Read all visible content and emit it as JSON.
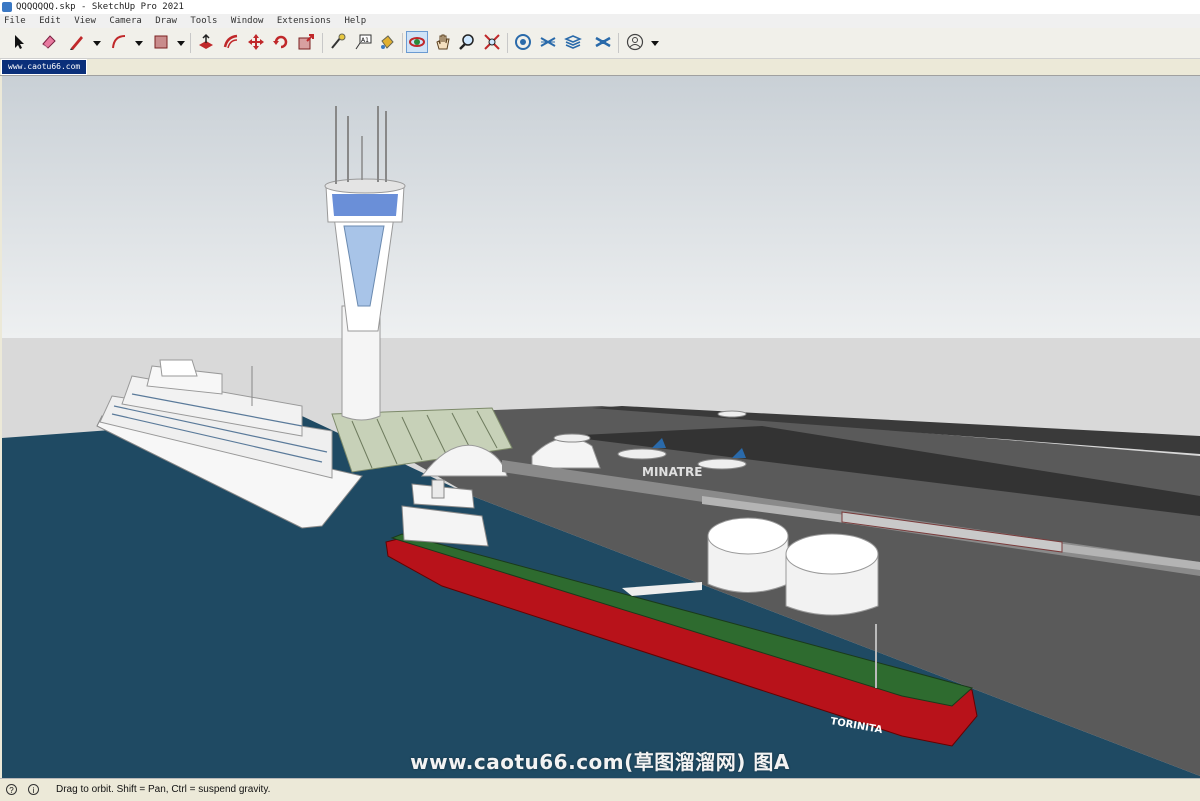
{
  "window": {
    "title": "QQQQQQQ.skp - SketchUp Pro 2021"
  },
  "menu": [
    "File",
    "Edit",
    "View",
    "Camera",
    "Draw",
    "Tools",
    "Window",
    "Extensions",
    "Help"
  ],
  "toolbar": {
    "tools": [
      {
        "name": "select-tool",
        "icon": "arrow-cursor-icon"
      },
      {
        "name": "eraser-tool",
        "icon": "eraser-icon"
      },
      {
        "name": "line-tool",
        "icon": "pencil-icon"
      },
      {
        "name": "arc-tool",
        "icon": "arc-icon"
      },
      {
        "name": "shape-tool",
        "icon": "rectangle-icon"
      },
      {
        "name": "push-pull-tool",
        "icon": "push-pull-icon"
      },
      {
        "name": "offset-tool",
        "icon": "offset-icon"
      },
      {
        "name": "move-tool",
        "icon": "move-icon"
      },
      {
        "name": "rotate-tool",
        "icon": "rotate-icon"
      },
      {
        "name": "scale-tool",
        "icon": "scale-icon"
      },
      {
        "name": "tape-measure-tool",
        "icon": "tape-measure-icon"
      },
      {
        "name": "text-tool",
        "icon": "text-icon"
      },
      {
        "name": "paint-bucket-tool",
        "icon": "paint-bucket-icon"
      },
      {
        "name": "orbit-tool",
        "icon": "orbit-icon",
        "active": true
      },
      {
        "name": "pan-tool",
        "icon": "hand-icon"
      },
      {
        "name": "zoom-tool",
        "icon": "magnifier-icon"
      },
      {
        "name": "zoom-extents-tool",
        "icon": "zoom-extents-icon"
      },
      {
        "name": "warehouse-tool",
        "icon": "warehouse-icon"
      },
      {
        "name": "extension-warehouse-tool",
        "icon": "extension-icon"
      },
      {
        "name": "layout-tool",
        "icon": "layout-icon"
      },
      {
        "name": "extension-manager-tool",
        "icon": "extension-manager-icon"
      },
      {
        "name": "account-tool",
        "icon": "user-icon"
      }
    ]
  },
  "tab": {
    "label": "www.caotu66.com"
  },
  "scene": {
    "sea_color": "#1f4a63",
    "ground_color": "#5a5a5a",
    "sky_top": "#c9d0d6",
    "sky_bottom": "#eef0f1",
    "hull_color": "#b8121a",
    "deck_color": "#2e6b2f",
    "tanker_name": "TORINITA",
    "terminal_sign": "MINATRE"
  },
  "watermark": "www.caotu66.com(草图溜溜网) 图A",
  "status": {
    "text": "Drag to orbit. Shift = Pan, Ctrl = suspend gravity."
  }
}
